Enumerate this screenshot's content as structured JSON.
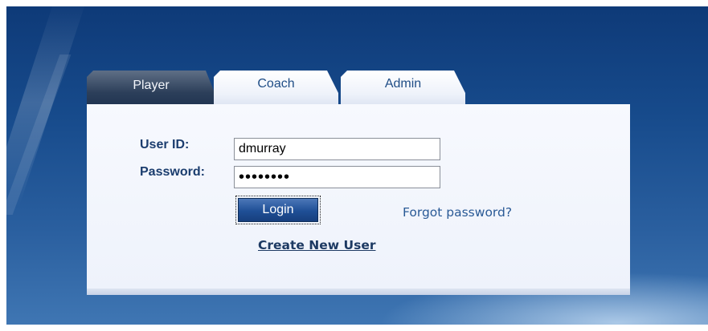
{
  "tabs": [
    {
      "label": "Player",
      "active": true
    },
    {
      "label": "Coach",
      "active": false
    },
    {
      "label": "Admin",
      "active": false
    }
  ],
  "form": {
    "user_id_label": "User ID:",
    "user_id_value": "dmurray",
    "password_label": "Password:",
    "password_value": "••••••••",
    "login_label": "Login",
    "forgot_label": "Forgot password?",
    "create_label": "Create New User"
  },
  "colors": {
    "background": "#174b8c",
    "panel": "#f4f7fd",
    "accent": "#1f4f96",
    "label_text": "#1b3d6e",
    "link": "#2a5a96"
  }
}
